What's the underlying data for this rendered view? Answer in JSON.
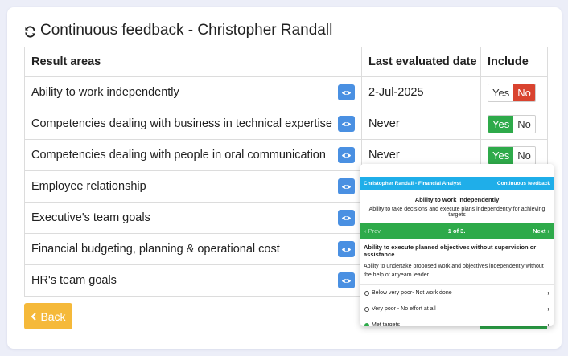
{
  "title": "Continuous feedback - Christopher Randall",
  "table": {
    "headers": [
      "Result areas",
      "Last evaluated date",
      "Include"
    ],
    "rows": [
      {
        "area": "Ability to work independently",
        "date": "2-Jul-2025",
        "yes": "Yes",
        "no": "No",
        "include": "no"
      },
      {
        "area": "Competencies dealing with business in technical expertise",
        "date": "Never",
        "yes": "Yes",
        "no": "No",
        "include": "yes"
      },
      {
        "area": "Competencies dealing with people in oral communication",
        "date": "Never",
        "yes": "Yes",
        "no": "No",
        "include": "yes"
      },
      {
        "area": "Employee relationship",
        "date": "",
        "yes": "",
        "no": "",
        "include": ""
      },
      {
        "area": "Executive's team goals",
        "date": "",
        "yes": "",
        "no": "",
        "include": ""
      },
      {
        "area": "Financial budgeting, planning & operational cost",
        "date": "",
        "yes": "",
        "no": "",
        "include": ""
      },
      {
        "area": "HR's team goals",
        "date": "",
        "yes": "",
        "no": "",
        "include": ""
      }
    ]
  },
  "back_label": "Back",
  "popup": {
    "header_left": "Christopher Randall - Financial Analyst",
    "header_right": "Continuous feedback",
    "area_title": "Ability to work independently",
    "area_desc": "Ability to take decisions and execute plans independently for achieving targets",
    "prev": "Prev",
    "pager": "1 of 3.",
    "next": "Next",
    "question": "Ability to execute planned objectives without supervision or assistance",
    "question_desc": "Ability to undertake proposed work and objectives independently without the help of anyeam leader",
    "options": [
      {
        "label": "Below very poor- Not work done",
        "selected": false
      },
      {
        "label": "Very poor - No effort at all",
        "selected": false
      },
      {
        "label": "Met targets",
        "selected": true
      }
    ]
  },
  "colors": {
    "eye_button": "#4a90e2",
    "yes_active": "#2eaa4a",
    "no_active": "#d9432f",
    "back_button": "#f5b93a",
    "popup_header": "#1faee9",
    "popup_nav": "#2eaa4a"
  },
  "icons": {
    "title": "refresh-icon",
    "row_action": "eye-icon",
    "back": "chevron-left-icon",
    "option": "chevron-right-icon"
  }
}
